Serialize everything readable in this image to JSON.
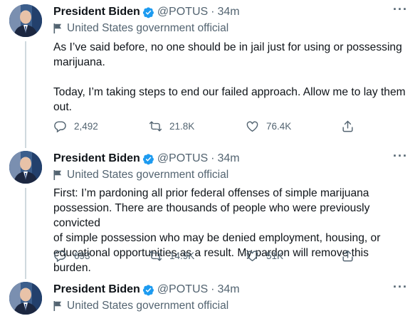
{
  "tweets": [
    {
      "name": "President Biden",
      "handle": "@POTUS",
      "separator": "·",
      "time": "34m",
      "label": "United States government official",
      "text": "As I’ve said before, no one should be in jail just for using or possessing\nmarijuana.\n\nToday, I’m taking steps to end our failed approach. Allow me to lay them\nout.",
      "replies": "2,492",
      "retweets": "21.8K",
      "likes": "76.4K",
      "more": "···"
    },
    {
      "name": "President Biden",
      "handle": "@POTUS",
      "separator": "·",
      "time": "34m",
      "label": "United States government official",
      "text": "First: I’m pardoning all prior federal offenses of simple marijuana\npossession. There are thousands of people who were previously convicted\nof simple possession who may be denied employment, housing, or\neducational opportunities as a result. My pardon will remove this burden.",
      "replies": "693",
      "retweets": "14.9K",
      "likes": "51K",
      "more": "···"
    },
    {
      "name": "President Biden",
      "handle": "@POTUS",
      "separator": "·",
      "time": "34m",
      "label": "United States government official",
      "more": "···"
    }
  ],
  "colors": {
    "verified": "#1d9bf0",
    "secondary_text": "#536471",
    "thread_line": "#cfd9de"
  },
  "icons": [
    "verified-badge-icon",
    "flag-icon",
    "reply-icon",
    "retweet-icon",
    "like-icon",
    "share-icon",
    "more-icon"
  ]
}
